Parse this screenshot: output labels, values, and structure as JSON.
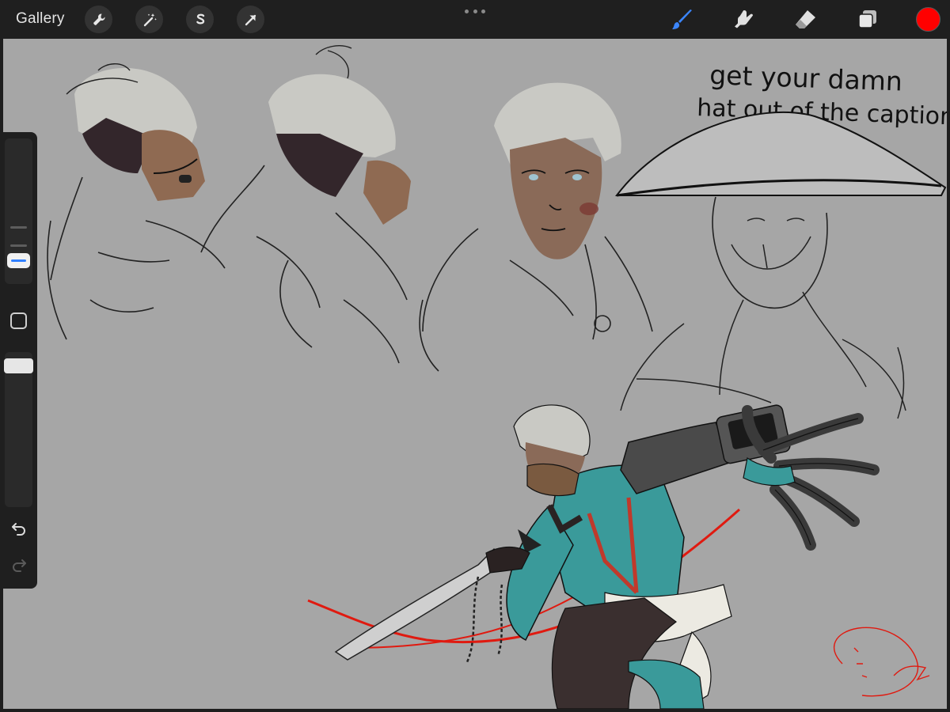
{
  "topbar": {
    "gallery_label": "Gallery",
    "left_tools": [
      "wrench-icon",
      "magic-wand-icon",
      "selection-s-icon",
      "transform-arrow-icon"
    ],
    "right_tools": [
      "brush-icon",
      "smudge-icon",
      "eraser-icon",
      "layers-icon"
    ],
    "active_tool": "brush",
    "current_color": "#ff0000"
  },
  "sidebar": {
    "size_slider_value": 0.2,
    "opacity_slider_value": 1.0
  },
  "canvas": {
    "background": "#a6a6a6",
    "sketch_caption_line1": "get your damn",
    "sketch_caption_line2": "hat out of the caption"
  },
  "colors": {
    "accent": "#2f7fff",
    "toolbar_bg": "#1f1f1f",
    "teal": "#3a9a9a",
    "red": "#e01a10"
  }
}
